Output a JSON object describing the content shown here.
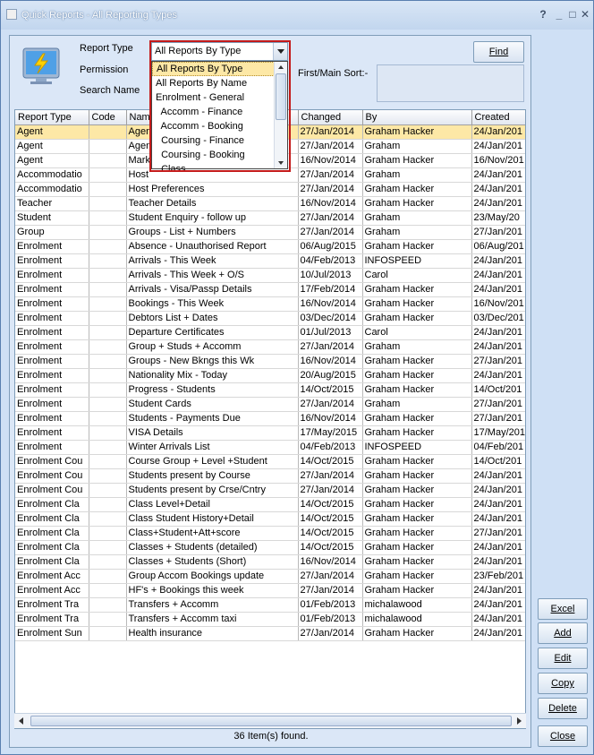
{
  "window": {
    "title": "Quick Reports - All Reporting Types"
  },
  "filters": {
    "report_type_label": "Report Type",
    "permission_label": "Permission",
    "search_name_label": "Search Name",
    "report_type_value": "All Reports By Type",
    "first_sort_label": "First/Main Sort:-",
    "find_label": "Find"
  },
  "dropdown": {
    "options": [
      "All Reports By Type",
      "All Reports By Name",
      "Enrolment - General",
      "  Accomm - Finance",
      "  Accomm - Booking",
      "  Coursing - Finance",
      "  Coursing - Booking",
      "  Class"
    ],
    "selected_index": 0
  },
  "grid": {
    "columns": [
      "Report Type",
      "Code",
      "Name",
      "Changed",
      "By",
      "Created"
    ],
    "rows": [
      [
        "Agent",
        "",
        "Agen",
        "27/Jan/2014",
        "Graham Hacker",
        "24/Jan/201"
      ],
      [
        "Agent",
        "",
        "Agen",
        "27/Jan/2014",
        "Graham",
        "24/Jan/201"
      ],
      [
        "Agent",
        "",
        "Mark",
        "16/Nov/2014",
        "Graham Hacker",
        "16/Nov/201"
      ],
      [
        "Accommodatio",
        "",
        "Host",
        "27/Jan/2014",
        "Graham",
        "24/Jan/201"
      ],
      [
        "Accommodatio",
        "",
        "Host Preferences",
        "27/Jan/2014",
        "Graham Hacker",
        "24/Jan/201"
      ],
      [
        "Teacher",
        "",
        "Teacher Details",
        "16/Nov/2014",
        "Graham Hacker",
        "24/Jan/201"
      ],
      [
        "Student",
        "",
        "Student Enquiry - follow up",
        "27/Jan/2014",
        "Graham",
        "23/May/20"
      ],
      [
        "Group",
        "",
        "Groups - List + Numbers",
        "27/Jan/2014",
        "Graham",
        "27/Jan/201"
      ],
      [
        "Enrolment",
        "",
        "Absence - Unauthorised Report",
        "06/Aug/2015",
        "Graham Hacker",
        "06/Aug/201"
      ],
      [
        "Enrolment",
        "",
        "Arrivals - This Week",
        "04/Feb/2013",
        "INFOSPEED",
        "24/Jan/201"
      ],
      [
        "Enrolment",
        "",
        "Arrivals - This Week + O/S",
        "10/Jul/2013",
        "Carol",
        "24/Jan/201"
      ],
      [
        "Enrolment",
        "",
        "Arrivals - Visa/Passp Details",
        "17/Feb/2014",
        "Graham Hacker",
        "24/Jan/201"
      ],
      [
        "Enrolment",
        "",
        "Bookings - This Week",
        "16/Nov/2014",
        "Graham Hacker",
        "16/Nov/201"
      ],
      [
        "Enrolment",
        "",
        "Debtors List + Dates",
        "03/Dec/2014",
        "Graham Hacker",
        "03/Dec/201"
      ],
      [
        "Enrolment",
        "",
        "Departure Certificates",
        "01/Jul/2013",
        "Carol",
        "24/Jan/201"
      ],
      [
        "Enrolment",
        "",
        "Group + Studs + Accomm",
        "27/Jan/2014",
        "Graham",
        "24/Jan/201"
      ],
      [
        "Enrolment",
        "",
        "Groups - New Bkngs this Wk",
        "16/Nov/2014",
        "Graham Hacker",
        "27/Jan/201"
      ],
      [
        "Enrolment",
        "",
        "Nationality Mix - Today",
        "20/Aug/2015",
        "Graham Hacker",
        "24/Jan/201"
      ],
      [
        "Enrolment",
        "",
        "Progress - Students",
        "14/Oct/2015",
        "Graham Hacker",
        "14/Oct/201"
      ],
      [
        "Enrolment",
        "",
        "Student Cards",
        "27/Jan/2014",
        "Graham",
        "27/Jan/201"
      ],
      [
        "Enrolment",
        "",
        "Students - Payments Due",
        "16/Nov/2014",
        "Graham Hacker",
        "27/Jan/201"
      ],
      [
        "Enrolment",
        "",
        "VISA Details",
        "17/May/2015",
        "Graham Hacker",
        "17/May/201"
      ],
      [
        "Enrolment",
        "",
        "Winter Arrivals List",
        "04/Feb/2013",
        "INFOSPEED",
        "04/Feb/201"
      ],
      [
        "Enrolment Cou",
        "",
        "Course Group + Level +Student",
        "14/Oct/2015",
        "Graham Hacker",
        "14/Oct/201"
      ],
      [
        "Enrolment Cou",
        "",
        "Students present by Course",
        "27/Jan/2014",
        "Graham Hacker",
        "24/Jan/201"
      ],
      [
        "Enrolment Cou",
        "",
        "Students present by Crse/Cntry",
        "27/Jan/2014",
        "Graham Hacker",
        "24/Jan/201"
      ],
      [
        "Enrolment Cla",
        "",
        "Class Level+Detail",
        "14/Oct/2015",
        "Graham Hacker",
        "24/Jan/201"
      ],
      [
        "Enrolment Cla",
        "",
        "Class Student History+Detail",
        "14/Oct/2015",
        "Graham Hacker",
        "24/Jan/201"
      ],
      [
        "Enrolment Cla",
        "",
        "Class+Student+Att+score",
        "14/Oct/2015",
        "Graham Hacker",
        "27/Jan/201"
      ],
      [
        "Enrolment Cla",
        "",
        "Classes + Students (detailed)",
        "14/Oct/2015",
        "Graham Hacker",
        "24/Jan/201"
      ],
      [
        "Enrolment Cla",
        "",
        "Classes + Students (Short)",
        "16/Nov/2014",
        "Graham Hacker",
        "24/Jan/201"
      ],
      [
        "Enrolment Acc",
        "",
        "Group Accom Bookings update",
        "27/Jan/2014",
        "Graham Hacker",
        "23/Feb/201"
      ],
      [
        "Enrolment Acc",
        "",
        "HF's + Bookings this week",
        "27/Jan/2014",
        "Graham Hacker",
        "24/Jan/201"
      ],
      [
        "Enrolment Tra",
        "",
        "Transfers + Accomm",
        "01/Feb/2013",
        "michalawood",
        "24/Jan/201"
      ],
      [
        "Enrolment Tra",
        "",
        "Transfers + Accomm taxi",
        "01/Feb/2013",
        "michalawood",
        "24/Jan/201"
      ],
      [
        "Enrolment Sun",
        "",
        "Health insurance",
        "27/Jan/2014",
        "Graham Hacker",
        "24/Jan/201"
      ]
    ],
    "selected_row": 0
  },
  "status": {
    "text": "36 Item(s) found."
  },
  "side_buttons": [
    {
      "name": "excel-button",
      "label": "Excel"
    },
    {
      "name": "add-button",
      "label": "Add"
    },
    {
      "name": "edit-button",
      "label": "Edit"
    },
    {
      "name": "copy-button",
      "label": "Copy"
    },
    {
      "name": "delete-button",
      "label": "Delete"
    },
    {
      "name": "close-button",
      "label": "Close"
    }
  ],
  "colors": {
    "selection": "#fde8a6",
    "highlight_border": "#c41a1a",
    "window_bg": "#cfe0f5"
  }
}
